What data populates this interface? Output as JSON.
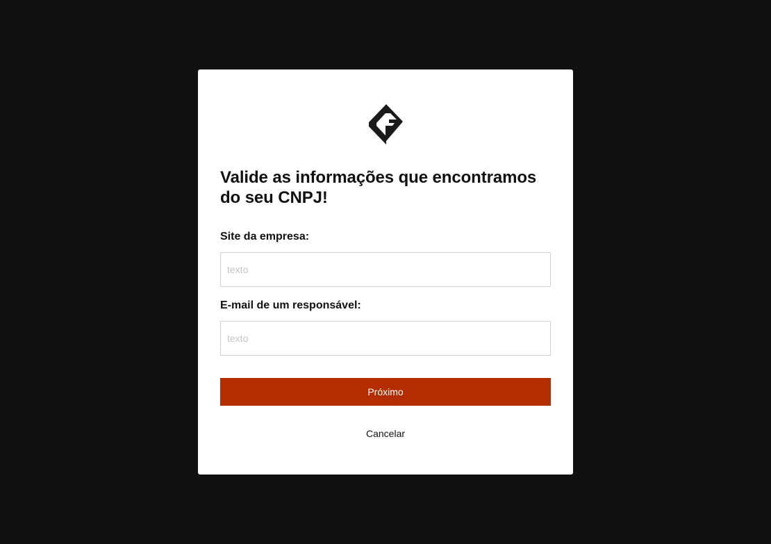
{
  "modal": {
    "logo_icon": "brand-logo-icon",
    "title": "Valide as informações que encontramos do seu CNPJ!",
    "fields": [
      {
        "label": "Site da empresa:",
        "placeholder": "texto",
        "value": ""
      },
      {
        "label": "E-mail de um responsável:",
        "placeholder": "texto",
        "value": ""
      }
    ],
    "primary_button": "Próximo",
    "cancel_label": "Cancelar"
  },
  "colors": {
    "backdrop": "#111111",
    "modal_background": "#ffffff",
    "primary_button": "#b32d00",
    "input_border": "#cfcfcf"
  }
}
